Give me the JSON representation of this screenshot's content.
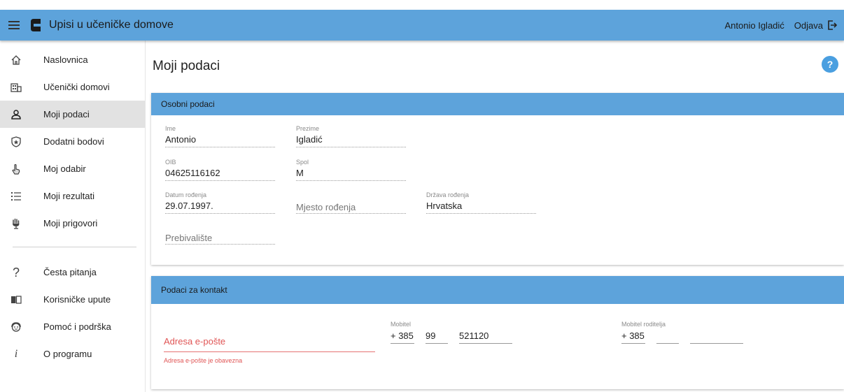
{
  "topbar": {
    "title": "Upisi u učeničke domove",
    "user_name": "Antonio Igladić",
    "logout_label": "Odjava"
  },
  "sidebar": {
    "items": [
      {
        "label": "Naslovnica",
        "icon": "home-icon"
      },
      {
        "label": "Učenički domovi",
        "icon": "building-icon"
      },
      {
        "label": "Moji podaci",
        "icon": "person-icon",
        "active": true
      },
      {
        "label": "Dodatni bodovi",
        "icon": "shield-star-icon"
      },
      {
        "label": "Moj odabir",
        "icon": "pointer-hand-icon"
      },
      {
        "label": "Moji rezultati",
        "icon": "list-icon"
      },
      {
        "label": "Moji prigovori",
        "icon": "raised-hand-icon"
      }
    ],
    "secondary_items": [
      {
        "label": "Česta pitanja",
        "icon": "question-icon"
      },
      {
        "label": "Korisničke upute",
        "icon": "book-icon"
      },
      {
        "label": "Pomoć i podrška",
        "icon": "support-icon"
      },
      {
        "label": "O programu",
        "icon": "info-icon"
      }
    ]
  },
  "main": {
    "page_title": "Moji podaci",
    "help_label": "?"
  },
  "personal": {
    "header": "Osobni podaci",
    "ime": {
      "label": "Ime",
      "value": "Antonio"
    },
    "prezime": {
      "label": "Prezime",
      "value": "Igladić"
    },
    "oib": {
      "label": "OIB",
      "value": "04625116162"
    },
    "spol": {
      "label": "Spol",
      "value": "M"
    },
    "datum": {
      "label": "Datum rođenja",
      "value": "29.07.1997."
    },
    "mjesto": {
      "placeholder": "Mjesto rođenja"
    },
    "drzava": {
      "label": "Država rođenja",
      "value": "Hrvatska"
    },
    "prebivaliste": {
      "placeholder": "Prebivalište"
    }
  },
  "contact": {
    "header": "Podaci za kontakt",
    "email_placeholder": "Adresa e-pošte",
    "email_error": "Adresa e-pošte je obavezna",
    "mobile": {
      "label": "Mobitel",
      "country": "+ 385",
      "prefix": "99",
      "number": "521120"
    },
    "parent_mobile": {
      "label": "Mobitel roditelja",
      "country": "+ 385",
      "prefix": "",
      "number": ""
    }
  },
  "colors": {
    "accent": "#5da3db",
    "active_nav": "#e2e2e2",
    "error": "#e05555",
    "help": "#4a9fe0"
  }
}
